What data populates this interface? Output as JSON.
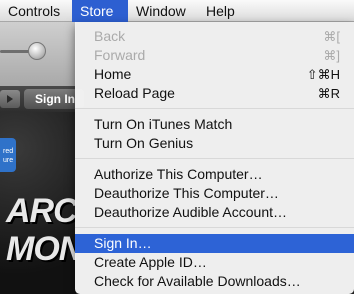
{
  "menubar": {
    "items": [
      {
        "label": "Controls",
        "active": false
      },
      {
        "label": "Store",
        "active": true
      },
      {
        "label": "Window",
        "active": false
      },
      {
        "label": "Help",
        "active": false
      }
    ]
  },
  "background": {
    "sign_in_button": "Sign In",
    "promo_badge": [
      "red",
      "ure"
    ],
    "promo_lines": [
      "ARC",
      "MONS"
    ]
  },
  "store_menu": {
    "groups": [
      [
        {
          "label": "Back",
          "shortcut": "⌘[",
          "enabled": false
        },
        {
          "label": "Forward",
          "shortcut": "⌘]",
          "enabled": false
        },
        {
          "label": "Home",
          "shortcut": "⇧⌘H",
          "enabled": true
        },
        {
          "label": "Reload Page",
          "shortcut": "⌘R",
          "enabled": true
        }
      ],
      [
        {
          "label": "Turn On iTunes Match",
          "shortcut": "",
          "enabled": true
        },
        {
          "label": "Turn On Genius",
          "shortcut": "",
          "enabled": true
        }
      ],
      [
        {
          "label": "Authorize This Computer…",
          "shortcut": "",
          "enabled": true
        },
        {
          "label": "Deauthorize This Computer…",
          "shortcut": "",
          "enabled": true
        },
        {
          "label": "Deauthorize Audible Account…",
          "shortcut": "",
          "enabled": true
        }
      ],
      [
        {
          "label": "Sign In…",
          "shortcut": "",
          "enabled": true,
          "highlighted": true
        },
        {
          "label": "Create Apple ID…",
          "shortcut": "",
          "enabled": true
        },
        {
          "label": "Check for Available Downloads…",
          "shortcut": "",
          "enabled": true
        }
      ]
    ]
  },
  "colors": {
    "highlight": "#2d63d6",
    "disabled_text": "#aaaaaa"
  }
}
